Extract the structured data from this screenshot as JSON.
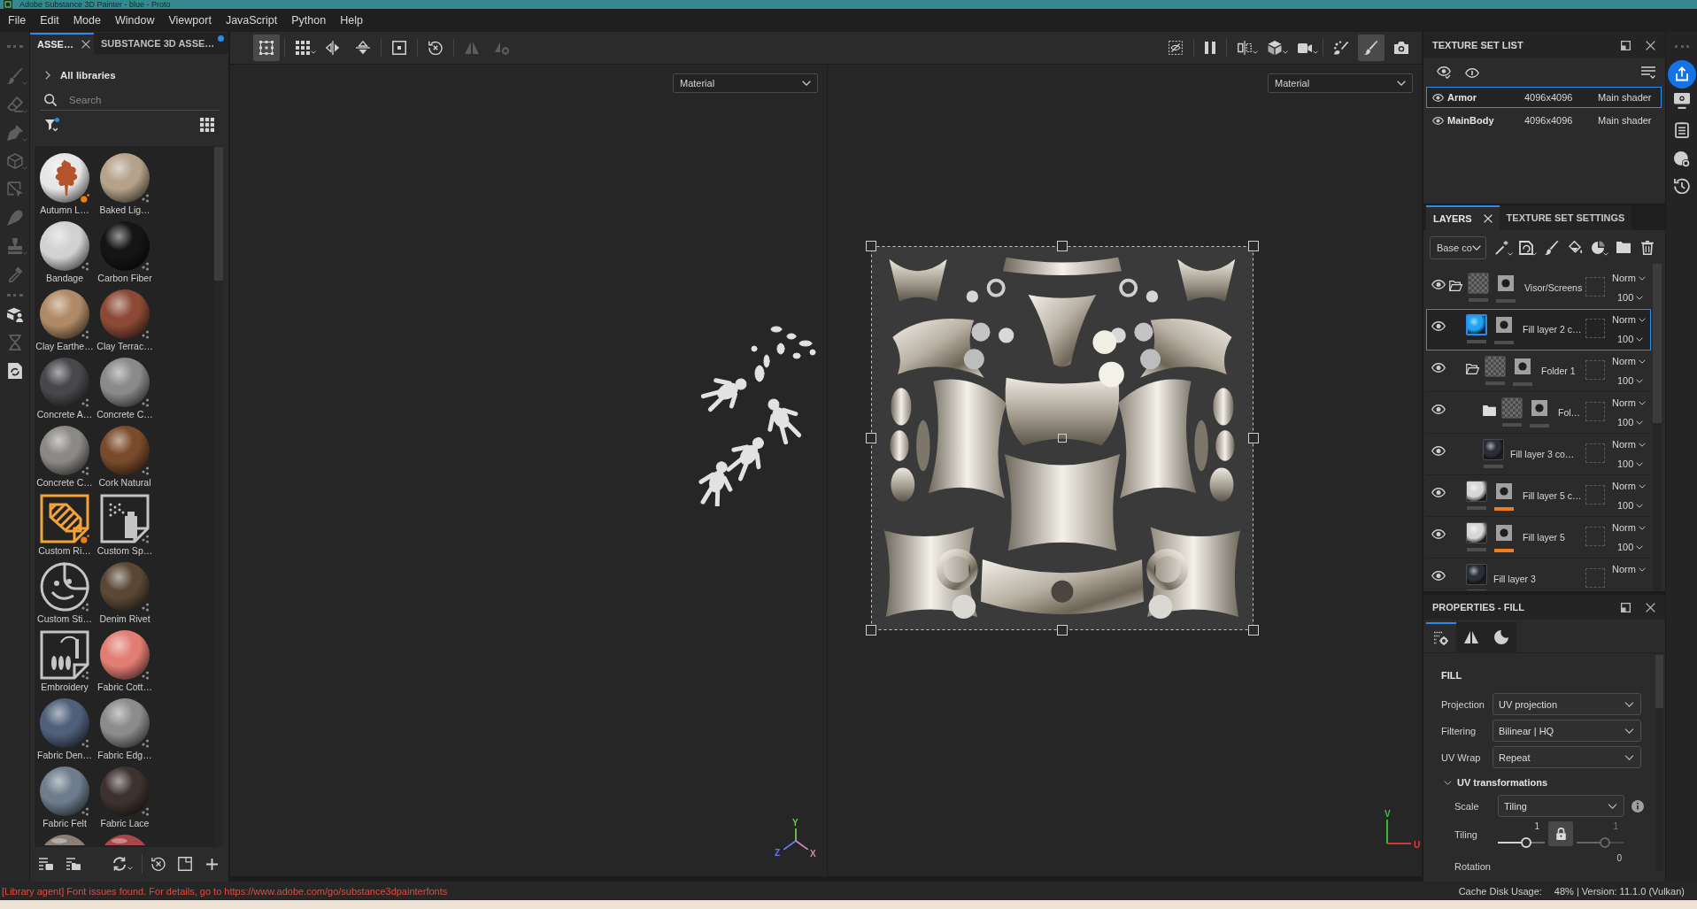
{
  "window": {
    "title": "Adobe Substance 3D Painter - blue - Proto"
  },
  "menu": [
    "File",
    "Edit",
    "Mode",
    "Window",
    "Viewport",
    "JavaScript",
    "Python",
    "Help"
  ],
  "tool_groups": [
    [
      {
        "kind": "brush",
        "disabled": true,
        "has_menu": true
      },
      {
        "kind": "eraser",
        "disabled": true,
        "has_menu": true
      },
      {
        "kind": "pen",
        "disabled": true,
        "has_menu": true
      },
      {
        "kind": "cube",
        "disabled": true,
        "has_menu": true
      },
      {
        "kind": "polygon-cursor",
        "disabled": true,
        "has_menu": false
      },
      {
        "kind": "teardrop",
        "disabled": true,
        "has_menu": false
      },
      {
        "kind": "stamp",
        "disabled": true,
        "has_menu": true
      },
      {
        "kind": "eyedropper",
        "disabled": true,
        "has_menu": false
      }
    ],
    [
      {
        "kind": "box-person",
        "disabled": false,
        "has_menu": false
      },
      {
        "kind": "hourglass",
        "disabled": true,
        "has_menu": false
      },
      {
        "kind": "refresh-page",
        "disabled": false,
        "has_menu": false
      }
    ]
  ],
  "assets": {
    "tabs": [
      {
        "label": "ASSE…",
        "selected": true,
        "notification": false
      },
      {
        "label": "SUBSTANCE 3D ASSE…",
        "selected": false,
        "notification": true
      }
    ],
    "library": "All libraries",
    "search": {
      "placeholder": "Search"
    },
    "filter_active": true,
    "items": [
      {
        "label": "Autumn L…",
        "kind": "leaf-sphere",
        "color": "#e6e6e6",
        "highlighted": true
      },
      {
        "label": "Baked Lig…",
        "kind": "sphere",
        "color": "#b5a28a",
        "highlighted": false
      },
      {
        "label": "Bandage",
        "kind": "sphere",
        "color": "#d2d2d2",
        "highlighted": false
      },
      {
        "label": "Carbon Fiber",
        "kind": "sphere",
        "color": "#151515",
        "highlighted": false
      },
      {
        "label": "Clay Earthe…",
        "kind": "sphere",
        "color": "#b08a66",
        "highlighted": false
      },
      {
        "label": "Clay Terrac…",
        "kind": "sphere",
        "color": "#8c4a36",
        "highlighted": false
      },
      {
        "label": "Concrete A…",
        "kind": "sphere",
        "color": "#48484c",
        "highlighted": false
      },
      {
        "label": "Concrete C…",
        "kind": "sphere",
        "color": "#8a8a8a",
        "highlighted": false
      },
      {
        "label": "Concrete C…",
        "kind": "sphere",
        "color": "#8b8985",
        "highlighted": false
      },
      {
        "label": "Cork Natural",
        "kind": "sphere",
        "color": "#7a4a2c",
        "highlighted": false
      },
      {
        "label": "Custom Ri…",
        "kind": "hatch-tile",
        "highlighted": true
      },
      {
        "label": "Custom Sp…",
        "kind": "spray-tile",
        "highlighted": false
      },
      {
        "label": "Custom Sti…",
        "kind": "sticker-tile",
        "highlighted": false
      },
      {
        "label": "Denim Rivet",
        "kind": "sphere",
        "color": "#5a4836",
        "highlighted": false
      },
      {
        "label": "Embroidery",
        "kind": "needle-tile",
        "highlighted": false
      },
      {
        "label": "Fabric Cott…",
        "kind": "sphere",
        "color": "#e27d74",
        "highlighted": false
      },
      {
        "label": "Fabric Den…",
        "kind": "sphere",
        "color": "#50607a",
        "highlighted": false
      },
      {
        "label": "Fabric Edg…",
        "kind": "sphere",
        "color": "#8c8c8c",
        "highlighted": false
      },
      {
        "label": "Fabric Felt",
        "kind": "sphere",
        "color": "#6e7c8c",
        "highlighted": false
      },
      {
        "label": "Fabric Lace",
        "kind": "sphere",
        "color": "#3e3230",
        "highlighted": false
      },
      {
        "kind": "sphere-top",
        "color": "#8a7f76"
      },
      {
        "kind": "sphere-top",
        "color": "#a8464c"
      }
    ]
  },
  "viewport_toolbar": {
    "left": [
      [
        {
          "kind": "nodes-square",
          "selected": true,
          "disabled": false,
          "has_menu": false
        }
      ],
      [
        {
          "kind": "grid",
          "selected": false,
          "disabled": false,
          "has_menu": true
        },
        {
          "kind": "flip-horizontal",
          "selected": false,
          "disabled": false,
          "has_menu": false
        },
        {
          "kind": "flip-vertical",
          "selected": false,
          "disabled": false,
          "has_menu": false
        }
      ],
      [
        {
          "kind": "focus-square",
          "selected": false,
          "disabled": false,
          "has_menu": false
        }
      ],
      [
        {
          "kind": "reset-clock",
          "selected": false,
          "disabled": false,
          "has_menu": false
        }
      ],
      [
        {
          "kind": "triangle-mirror",
          "selected": false,
          "disabled": true,
          "has_menu": false
        },
        {
          "kind": "triangle-gear",
          "selected": false,
          "disabled": true,
          "has_menu": false
        }
      ]
    ],
    "right": [
      [
        {
          "kind": "eye-off-square",
          "selected": false,
          "disabled": false,
          "has_menu": false
        }
      ],
      [
        {
          "kind": "pause",
          "selected": false,
          "disabled": false,
          "has_menu": false
        }
      ],
      [
        {
          "kind": "split-view",
          "selected": false,
          "disabled": false,
          "has_menu": true
        },
        {
          "kind": "cube-solid",
          "selected": false,
          "disabled": false,
          "has_menu": true
        },
        {
          "kind": "video-camera",
          "selected": false,
          "disabled": false,
          "has_menu": true
        }
      ],
      [
        {
          "kind": "sparkle-brush",
          "selected": false,
          "disabled": false,
          "has_menu": false
        },
        {
          "kind": "brush",
          "selected": true,
          "disabled": false,
          "has_menu": false
        },
        {
          "kind": "camera",
          "selected": false,
          "disabled": false,
          "has_menu": false
        }
      ]
    ]
  },
  "viewports": [
    {
      "kind": "scene",
      "dropdown": "Material",
      "axes": [
        {
          "label": "Y",
          "color": "#6cc94a"
        },
        {
          "label": "Z",
          "color": "#6a74ff"
        },
        {
          "label": "X",
          "color": "#d08ab0"
        }
      ]
    },
    {
      "kind": "uv",
      "dropdown": "Material",
      "axes": [
        {
          "label": "V",
          "color": "#3fc43f"
        },
        {
          "label": "U",
          "color": "#e23b3b"
        }
      ]
    }
  ],
  "texture_sets": {
    "title": "TEXTURE SET LIST",
    "rows": [
      {
        "name": "Armor",
        "resolution": "4096x4096",
        "shader": "Main shader",
        "visible": true,
        "selected": true
      },
      {
        "name": "MainBody",
        "resolution": "4096x4096",
        "shader": "Main shader",
        "visible": true,
        "selected": false
      }
    ]
  },
  "layer_panel": {
    "tabs": [
      {
        "label": "LAYERS",
        "selected": true
      },
      {
        "label": "TEXTURE SET SETTINGS",
        "selected": false
      }
    ],
    "channel": "Base co",
    "layers": [
      {
        "name": "Visor/Screens",
        "kind": "folder",
        "expanded": true,
        "selected": false,
        "visible": true,
        "mask": true,
        "mask_bar_on": false,
        "blend": "Norm",
        "opacity": "100",
        "children": [
          {
            "name": "Fill layer 2 c…",
            "kind": "fill",
            "selected": true,
            "visible": true,
            "color": "#1fa4f2",
            "mask": true,
            "mask_bar_on": false,
            "blend": "Norm",
            "opacity": "100"
          },
          {
            "name": "Folder 1",
            "kind": "folder",
            "expanded": true,
            "selected": false,
            "visible": true,
            "mask": true,
            "mask_bar_on": false,
            "blend": "Norm",
            "opacity": "100",
            "children": [
              {
                "name": "Fol…",
                "kind": "folder",
                "expanded": false,
                "selected": false,
                "visible": true,
                "mask": true,
                "mask_bar_on": false,
                "blend": "Norm",
                "opacity": "100"
              },
              {
                "name": "Fill layer 3 co…",
                "kind": "fill",
                "selected": false,
                "visible": true,
                "color": "#2a2e38",
                "mask": false,
                "blend": "Norm",
                "opacity": "100"
              }
            ]
          },
          {
            "name": "Fill layer 5 c…",
            "kind": "fill",
            "selected": false,
            "visible": true,
            "color": "#d6d6d6",
            "mask": true,
            "mask_bar_on": true,
            "blend": "Norm",
            "opacity": "100"
          },
          {
            "name": "Fill layer 5",
            "kind": "fill",
            "selected": false,
            "visible": true,
            "color": "#d6d6d6",
            "mask": true,
            "mask_bar_on": true,
            "blend": "Norm",
            "opacity": "100"
          },
          {
            "name": "Fill layer 3",
            "kind": "fill",
            "selected": false,
            "visible": true,
            "color": "#2a2e38",
            "mask": false,
            "blend": "Norm"
          }
        ]
      }
    ]
  },
  "properties": {
    "title": "PROPERTIES - FILL",
    "tabs": [
      {
        "kind": "sliders-gear",
        "selected": true
      },
      {
        "kind": "triangle-mirror",
        "selected": false
      },
      {
        "kind": "moon",
        "selected": false
      }
    ],
    "section": "FILL",
    "fields": [
      {
        "label": "Projection",
        "value": "UV projection"
      },
      {
        "label": "Filtering",
        "value": "Bilinear | HQ"
      },
      {
        "label": "UV Wrap",
        "value": "Repeat"
      }
    ],
    "group": {
      "title": "UV transformations",
      "expanded": true,
      "scale": {
        "label": "Scale",
        "value": "Tiling"
      },
      "tiling": {
        "label": "Tiling",
        "locked": true,
        "sliders": [
          {
            "value": "1",
            "level": 0.6,
            "disabled": false
          },
          {
            "value": "1",
            "level": 0.6,
            "disabled": true
          }
        ]
      },
      "rotation": {
        "label": "Rotation",
        "value": "0"
      }
    }
  },
  "status": {
    "message": "[Library agent] Font issues found. For details, go to https://www.adobe.com/go/substance3dpainterfonts",
    "cache_label": "Cache Disk Usage:",
    "cache_info": "48% | Version: 11.1.0 (Vulkan)"
  }
}
